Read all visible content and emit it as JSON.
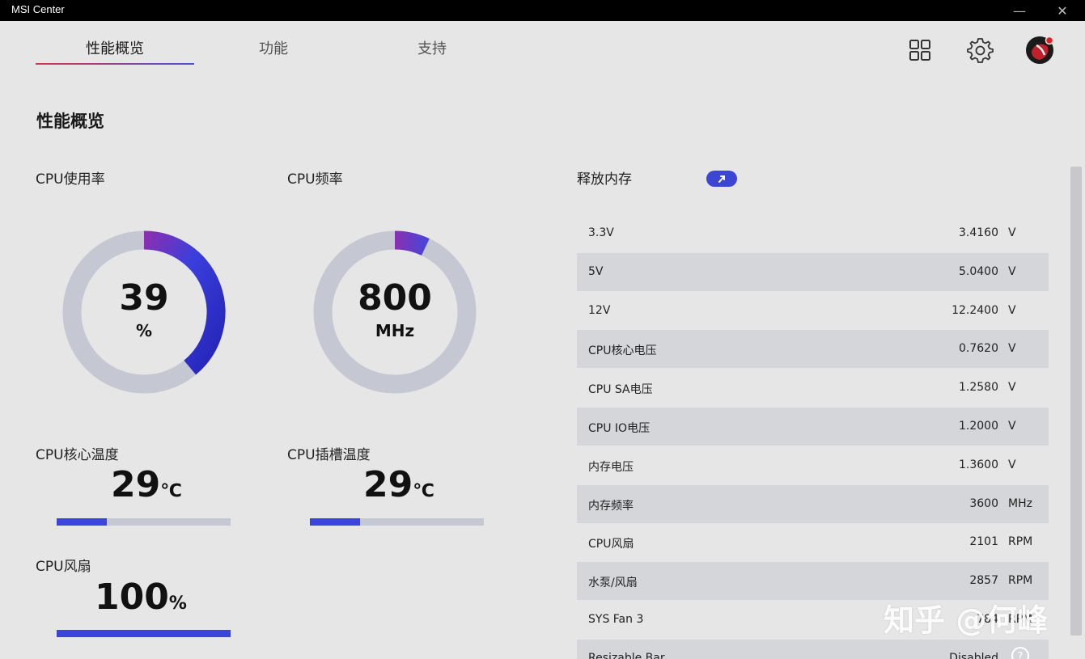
{
  "app": {
    "title": "MSI Center"
  },
  "window": {
    "minimize": "—",
    "close": "✕"
  },
  "tabs": [
    {
      "label": "性能概览"
    },
    {
      "label": "功能"
    },
    {
      "label": "支持"
    }
  ],
  "header_icons": [
    "grid-icon",
    "gear-icon",
    "avatar"
  ],
  "section": {
    "title": "性能概览"
  },
  "cpu_usage": {
    "label": "CPU使用率",
    "value": "39",
    "unit": "%",
    "fraction": 0.39
  },
  "cpu_freq": {
    "label": "CPU频率",
    "value": "800",
    "unit": "MHz",
    "fraction": 0.07
  },
  "cpu_core_temp": {
    "label": "CPU核心温度",
    "value": "29",
    "unit": "℃",
    "fraction": 0.29
  },
  "cpu_socket_temp": {
    "label": "CPU插槽温度",
    "value": "29",
    "unit": "℃",
    "fraction": 0.29
  },
  "cpu_fan": {
    "label": "CPU风扇",
    "value": "100",
    "unit": "%",
    "fraction": 1.0
  },
  "release_memory": {
    "label": "释放内存"
  },
  "voltages": [
    {
      "name": "3.3V",
      "value": "3.4160",
      "unit": "V"
    },
    {
      "name": "5V",
      "value": "5.0400",
      "unit": "V"
    },
    {
      "name": "12V",
      "value": "12.2400",
      "unit": "V"
    },
    {
      "name": "CPU核心电压",
      "value": "0.7620",
      "unit": "V"
    },
    {
      "name": "CPU SA电压",
      "value": "1.2580",
      "unit": "V"
    },
    {
      "name": "CPU IO电压",
      "value": "1.2000",
      "unit": "V"
    },
    {
      "name": "内存电压",
      "value": "1.3600",
      "unit": "V"
    },
    {
      "name": "内存频率",
      "value": "3600",
      "unit": "MHz"
    },
    {
      "name": "CPU风扇",
      "value": "2101",
      "unit": "RPM"
    },
    {
      "name": "水泵/风扇",
      "value": "2857",
      "unit": "RPM"
    },
    {
      "name": "SYS Fan 3",
      "value": "784",
      "unit": "RPM"
    },
    {
      "name": "Resizable Bar",
      "value": "Disabled",
      "unit": ""
    }
  ],
  "watermark": "知乎 @何峰",
  "colors": {
    "accent": "#3c46d6",
    "gauge_track": "#c5c8d2",
    "gauge_start": "#8a2fb0",
    "tab_underline_start": "#e0314f"
  }
}
